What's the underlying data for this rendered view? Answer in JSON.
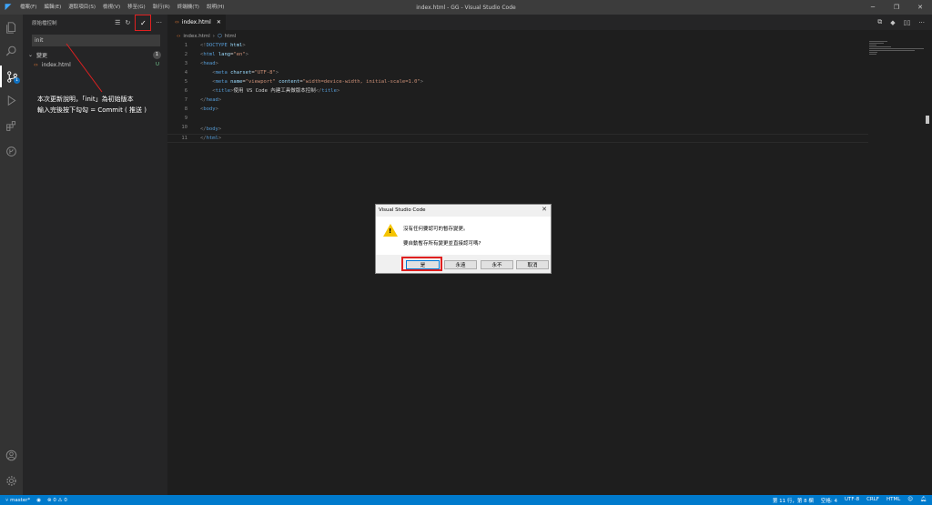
{
  "window": {
    "title": "index.html - GG - Visual Studio Code",
    "menu": [
      "檔案(F)",
      "編輯(E)",
      "選取項目(S)",
      "檢視(V)",
      "移至(G)",
      "執行(R)",
      "終端機(T)",
      "說明(H)"
    ]
  },
  "activity": {
    "scm_badge": "1"
  },
  "sidebar": {
    "title": "原始檔控制",
    "commit_message": "init",
    "group_label": "變更",
    "group_count": "1",
    "file_name": "index.html",
    "file_status": "U"
  },
  "annotation": {
    "line1": "本次更新說明，「init」為初始版本",
    "line2": "輸入完後按下勾勾 = Commit ( 推送 )"
  },
  "editor": {
    "tab_label": "index.html",
    "breadcrumb_file": "index.html",
    "breadcrumb_element": "html",
    "line_numbers": [
      "1",
      "2",
      "3",
      "4",
      "5",
      "6",
      "7",
      "8",
      "9",
      "10",
      "11"
    ]
  },
  "dialog": {
    "title": "Visual Studio Code",
    "message1": "沒有任何要認可的暫存變更。",
    "message2": "要自動暫存所有變更並直接認可嗎?",
    "btn_yes": "是",
    "btn_always": "永遠",
    "btn_never": "永不",
    "btn_cancel": "取消"
  },
  "status": {
    "branch": "master*",
    "problems": "0",
    "warnings": "0",
    "position": "第 11 行，第 8 欄",
    "spaces": "空格: 4",
    "encoding": "UTF-8",
    "eol": "CRLF",
    "language": "HTML"
  },
  "colors": {
    "accent": "#007acc",
    "highlight": "#e02020"
  }
}
